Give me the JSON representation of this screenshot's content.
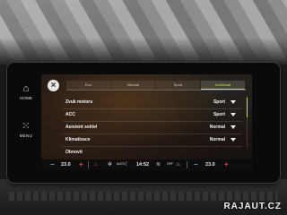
{
  "tabs": [
    "Eco",
    "Normal",
    "Sport",
    "Individual"
  ],
  "active_tab": "Individual",
  "left_rail": {
    "home_label": "HOME",
    "menu_label": "MENU"
  },
  "settings": [
    {
      "label": "Zvuk motoru",
      "value": "Sport"
    },
    {
      "label": "ACC",
      "value": "Sport"
    },
    {
      "label": "Asistent světel",
      "value": "Normal"
    },
    {
      "label": "Klimatizace",
      "value": "Normal"
    },
    {
      "label": "Obnovit",
      "value": ""
    }
  ],
  "status_bar": {
    "temp_left": "23.0",
    "clock": "14:52",
    "temp_right": "23.0",
    "auto_label": "AUTO",
    "off_label": "OFF"
  },
  "watermark": "RAJAUT.CZ",
  "colors": {
    "accent": "#c6e33c",
    "minus": "#5aa0e6",
    "plus": "#e0453a"
  }
}
